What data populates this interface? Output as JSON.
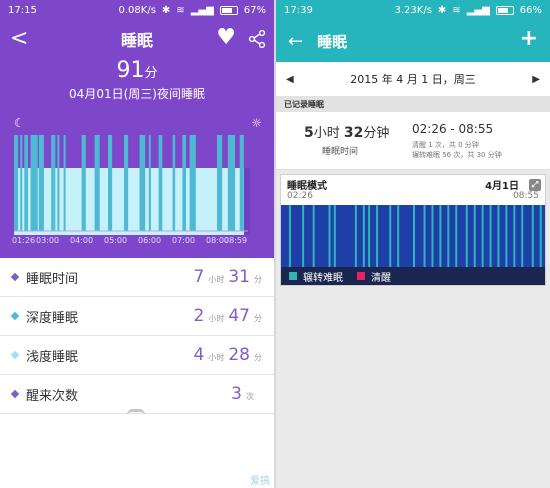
{
  "left": {
    "status": {
      "time": "17:15",
      "speed": "0.08K/s",
      "battery": "67%"
    },
    "title": "睡眠",
    "score_value": "91",
    "score_unit": "分",
    "subtitle": "04月01日(周三)夜间睡眠",
    "x_ticks": [
      "01:26",
      "03:00",
      "04:00",
      "05:00",
      "06:00",
      "07:00",
      "08:00",
      "08:59"
    ],
    "metrics": [
      {
        "label": "睡眠时间",
        "v1": "7",
        "u1": "小时",
        "v2": "31",
        "u2": "分",
        "color": "#7e5ec8"
      },
      {
        "label": "深度睡眠",
        "v1": "2",
        "u1": "小时",
        "v2": "47",
        "u2": "分",
        "color": "#4fb9d4"
      },
      {
        "label": "浅度睡眠",
        "v1": "4",
        "u1": "小时",
        "v2": "28",
        "u2": "分",
        "color": "#a6e0ee"
      },
      {
        "label": "醒来次数",
        "v1": "3",
        "u1": "次",
        "v2": "",
        "u2": "",
        "color": "#7e5ec8"
      }
    ],
    "watermark": "爱搞机",
    "colors": {
      "header": "#7e47c9",
      "deep": "#4fb9d4",
      "light": "#c6f1fb",
      "awake": "#7e47c9"
    }
  },
  "right": {
    "status": {
      "time": "17:39",
      "speed": "3.23K/s",
      "battery": "66%"
    },
    "title": "睡眠",
    "date": "2015 年 4 月 1 日，周三",
    "section": "已记录睡眠",
    "duration_hours": "5",
    "duration_hours_unit": "小时",
    "duration_minutes": "32",
    "duration_minutes_unit": "分钟",
    "duration_label": "睡眠时间",
    "time_range": "02:26 - 08:55",
    "awake_line": "清醒 1 次，共 0 分钟",
    "restless_line": "辗转难眠 56 次，共 30 分钟",
    "card_title": "睡眠模式",
    "card_date": "4月1日",
    "start": "02:26",
    "end": "08:55",
    "legend_restless": "辗转难眠",
    "legend_awake": "清醒",
    "colors": {
      "bar": "#26b5bc",
      "sleep": "#1e3fa8",
      "restless": "#2fb4b9",
      "awake": "#e0246b"
    }
  },
  "chart_data": {
    "type": "bar",
    "title": "",
    "xlabel": "",
    "ylabel": "",
    "x_ticks": [
      "01:26",
      "03:00",
      "04:00",
      "05:00",
      "06:00",
      "07:00",
      "08:00",
      "08:59"
    ],
    "deep_intervals_min": [
      [
        0,
        8
      ],
      [
        12,
        16
      ],
      [
        20,
        27
      ],
      [
        32,
        46
      ],
      [
        48,
        58
      ],
      [
        72,
        74
      ],
      [
        76,
        80
      ],
      [
        84,
        87
      ],
      [
        96,
        99
      ],
      [
        131,
        139
      ],
      [
        156,
        166
      ],
      [
        182,
        190
      ],
      [
        213,
        221
      ],
      [
        243,
        254
      ],
      [
        261,
        265
      ],
      [
        280,
        287
      ],
      [
        307,
        312
      ],
      [
        326,
        333
      ],
      [
        340,
        352
      ],
      [
        393,
        403
      ],
      [
        414,
        428
      ],
      [
        437,
        445
      ]
    ]
  }
}
